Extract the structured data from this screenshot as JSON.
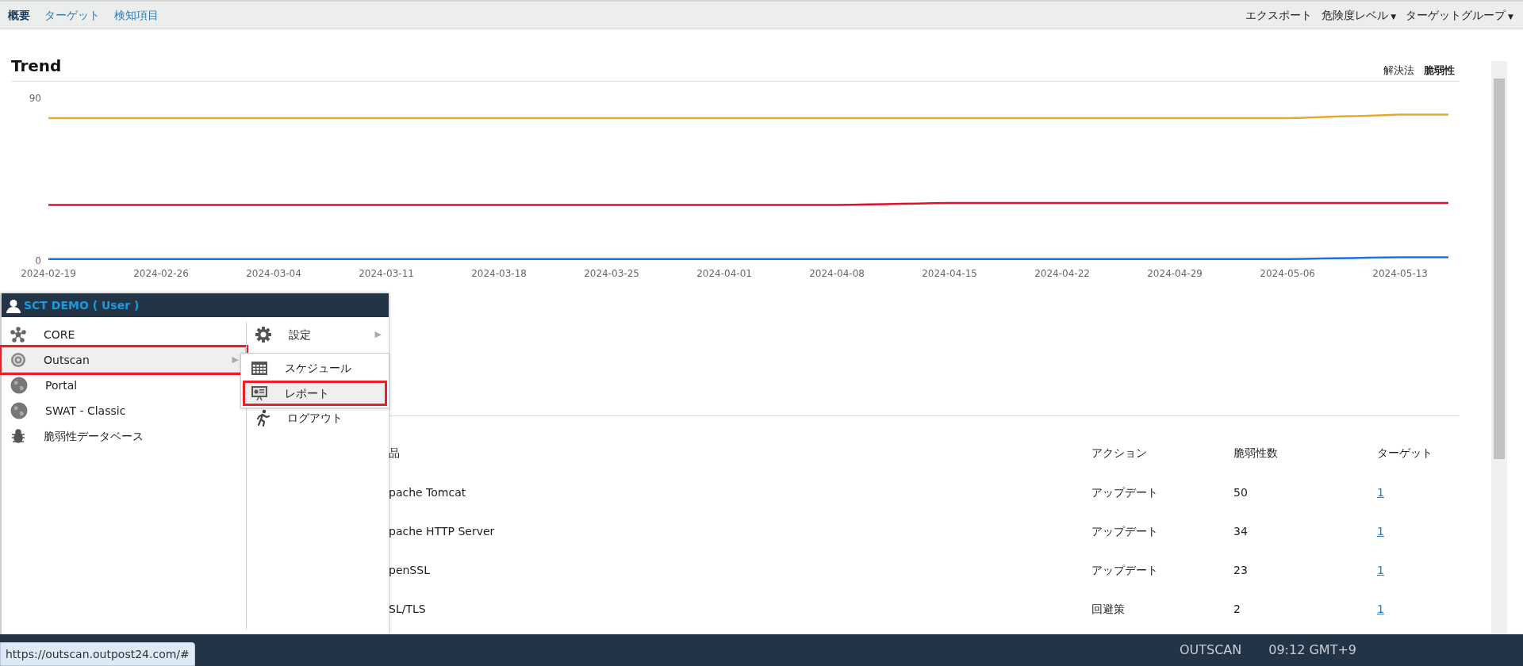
{
  "nav": {
    "tabs": [
      {
        "label": "概要",
        "selected": true
      },
      {
        "label": "ターゲット",
        "selected": false
      },
      {
        "label": "検知項目",
        "selected": false
      }
    ],
    "actions": [
      {
        "label": "エクスポート"
      },
      {
        "label": "危険度レベル",
        "caret": "▼"
      },
      {
        "label": "ターゲットグループ",
        "caret": "▼"
      }
    ]
  },
  "trend": {
    "title": "Trend",
    "toggles": [
      {
        "label": "解決法",
        "selected": false
      },
      {
        "label": "脆弱性",
        "selected": true
      }
    ],
    "chart_data": {
      "type": "line",
      "ylim": [
        0,
        90
      ],
      "yticks": [
        0,
        90
      ],
      "categories": [
        "2024-02-19",
        null,
        null,
        null,
        null,
        null,
        null,
        "2024-02-26",
        null,
        null,
        null,
        null,
        null,
        null,
        "2024-03-04",
        null,
        null,
        null,
        null,
        null,
        null,
        "2024-03-11",
        null,
        null,
        null,
        null,
        null,
        null,
        "2024-03-18",
        null,
        null,
        null,
        null,
        null,
        null,
        "2024-03-25",
        null,
        null,
        null,
        null,
        null,
        null,
        "2024-04-01",
        null,
        null,
        null,
        null,
        null,
        null,
        "2024-04-08",
        null,
        null,
        null,
        null,
        null,
        null,
        "2024-04-15",
        null,
        null,
        null,
        null,
        null,
        null,
        "2024-04-22",
        null,
        null,
        null,
        null,
        null,
        null,
        "2024-04-29",
        null,
        null,
        null,
        null,
        null,
        null,
        "2024-05-06",
        null,
        null,
        null,
        null,
        null,
        null,
        "2024-05-13",
        null,
        null,
        null
      ],
      "series": [
        {
          "color": "#e8a830",
          "values": [
            79,
            79,
            79,
            79,
            79,
            79,
            79,
            79,
            79,
            79,
            79,
            79,
            79,
            79,
            79,
            79,
            79,
            79,
            79,
            79,
            79,
            79,
            79,
            79,
            79,
            79,
            79,
            79,
            79,
            79,
            79,
            79,
            79,
            79,
            79,
            79,
            79,
            79,
            79,
            79,
            79,
            79,
            79,
            79,
            79,
            79,
            79,
            79,
            79,
            79,
            79,
            79,
            79,
            79,
            79,
            79,
            79,
            79,
            79,
            79,
            79,
            79,
            79,
            79,
            79,
            79,
            79,
            79,
            79,
            79,
            79,
            79,
            79,
            79,
            79,
            79,
            79,
            79,
            79.3,
            79.6,
            79.9,
            80.1,
            80.4,
            80.7,
            81,
            81,
            81,
            81
          ]
        },
        {
          "color": "#e0102a",
          "values": [
            31,
            31,
            31,
            31,
            31,
            31,
            31,
            31,
            31,
            31,
            31,
            31,
            31,
            31,
            31,
            31,
            31,
            31,
            31,
            31,
            31,
            31,
            31,
            31,
            31,
            31,
            31,
            31,
            31,
            31,
            31,
            31,
            31,
            31,
            31,
            31,
            31,
            31,
            31,
            31,
            31,
            31,
            31,
            31,
            31,
            31,
            31,
            31,
            31,
            31,
            31.1,
            31.3,
            31.4,
            31.6,
            31.7,
            31.9,
            32,
            32,
            32,
            32,
            32,
            32,
            32,
            32,
            32,
            32,
            32,
            32,
            32,
            32,
            32,
            32,
            32,
            32,
            32,
            32,
            32,
            32,
            32,
            32,
            32,
            32,
            32,
            32,
            32,
            32,
            32,
            32
          ]
        },
        {
          "color": "#1a73e8",
          "values": [
            1,
            1,
            1,
            1,
            1,
            1,
            1,
            1,
            1,
            1,
            1,
            1,
            1,
            1,
            1,
            1,
            1,
            1,
            1,
            1,
            1,
            1,
            1,
            1,
            1,
            1,
            1,
            1,
            1,
            1,
            1,
            1,
            1,
            1,
            1,
            1,
            1,
            1,
            1,
            1,
            1,
            1,
            1,
            1,
            1,
            1,
            1,
            1,
            1,
            1,
            1,
            1,
            1,
            1,
            1,
            1,
            1,
            1,
            1,
            1,
            1,
            1,
            1,
            1,
            1,
            1,
            1,
            1,
            1,
            1,
            1,
            1,
            1,
            1,
            1,
            1,
            1,
            1,
            1.1,
            1.3,
            1.4,
            1.6,
            1.7,
            1.9,
            2,
            2,
            2,
            2
          ]
        }
      ]
    }
  },
  "table": {
    "columns": [
      "品",
      "アクション",
      "脆弱性数",
      "ターゲット"
    ],
    "rows": [
      {
        "product": "pache Tomcat",
        "action": "アップデート",
        "count": "50",
        "targets": "1"
      },
      {
        "product": "pache HTTP Server",
        "action": "アップデート",
        "count": "34",
        "targets": "1"
      },
      {
        "product": "penSSL",
        "action": "アップデート",
        "count": "23",
        "targets": "1"
      },
      {
        "product": "SL/TLS",
        "action": "回避策",
        "count": "2",
        "targets": "1"
      }
    ]
  },
  "menu": {
    "user": "SCT DEMO ( User )",
    "items": [
      {
        "label": "CORE",
        "highlighted": false
      },
      {
        "label": "Outscan",
        "arrow": "▶",
        "highlighted": true
      },
      {
        "label": "Portal",
        "highlighted": false
      },
      {
        "label": "SWAT - Classic",
        "highlighted": false
      },
      {
        "label": "脆弱性データベース",
        "highlighted": false
      }
    ],
    "side_items": [
      {
        "label": "設定",
        "arrow": "▶"
      },
      {
        "label": "ログアウト"
      }
    ],
    "submenu": [
      {
        "label": "スケジュール",
        "highlighted": false
      },
      {
        "label": "レポート",
        "highlighted": true
      }
    ]
  },
  "status_bar": {
    "url": "https://outscan.outpost24.com/#",
    "product": "OUTSCAN",
    "time": "09:12 GMT+9"
  }
}
